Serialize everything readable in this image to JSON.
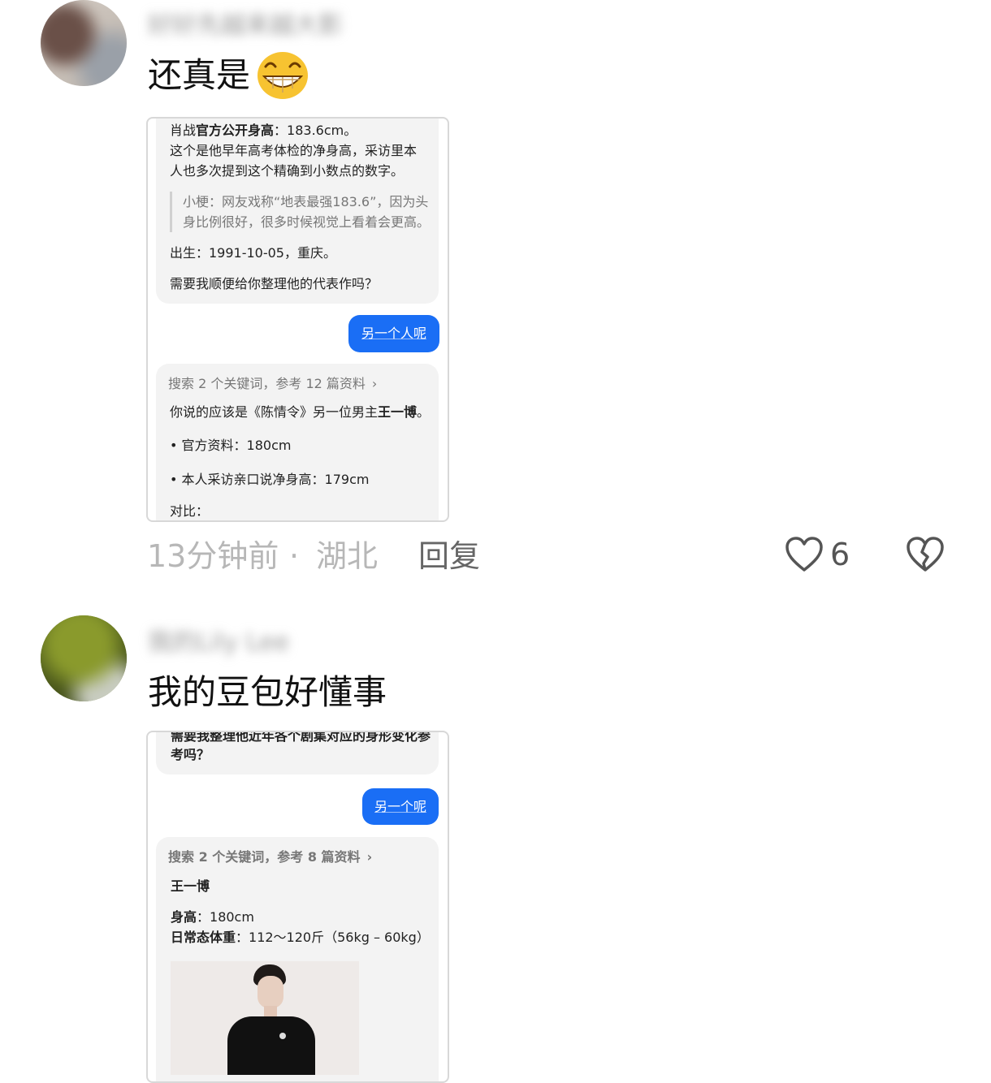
{
  "comments": [
    {
      "username": "好好先越来越大影",
      "text": "还真是",
      "emoji": "grinning-face-emoji",
      "screenshot": {
        "lines": [
          {
            "prefix": "肖战",
            "bold": "官方公开身高",
            "suffix": "：183.6cm。"
          },
          {
            "text": "这个是他早年高考体检的净身高，采访里本"
          },
          {
            "text": "人也多次提到这个精确到小数点的数字。"
          }
        ],
        "quote": [
          "小梗：网友戏称“地表最强183.6”，因为头",
          "身比例很好，很多时候视觉上看着会更高。"
        ],
        "birth": "出生：1991-10-05，重庆。",
        "question": "需要我顺便给你整理他的代表作吗？",
        "user_bubble": "另一个人呢",
        "search_info": "搜索 2 个关键词，参考 12 篇资料",
        "answer_prefix": "你说的应该是《陈情令》另一位男主",
        "answer_bold": "王一博",
        "answer_suffix": "。",
        "bullets": [
          "官方资料：180cm",
          "本人采访亲口说净身高：179cm"
        ],
        "compare": "对比："
      },
      "time": "13分钟前",
      "sep": "·",
      "location": "湖北",
      "reply_label": "回复",
      "like_count": "6",
      "like_icon": "heart-icon",
      "dislike_icon": "broken-heart-icon"
    },
    {
      "username": "我的Lily Lee",
      "text": "我的豆包好懂事",
      "screenshot": {
        "top_line": "需要我整理他近年各个剧集对应的身形变化参",
        "top_line2": "考吗？",
        "user_bubble": "另一个呢",
        "search_info": "搜索 2 个关键词，参考 8 篇资料",
        "name": "王一博",
        "height_label": "身高",
        "height_value": "：180cm",
        "weight_label": "日常态体重",
        "weight_value": "：112～120斤（56kg – 60kg）"
      }
    }
  ]
}
